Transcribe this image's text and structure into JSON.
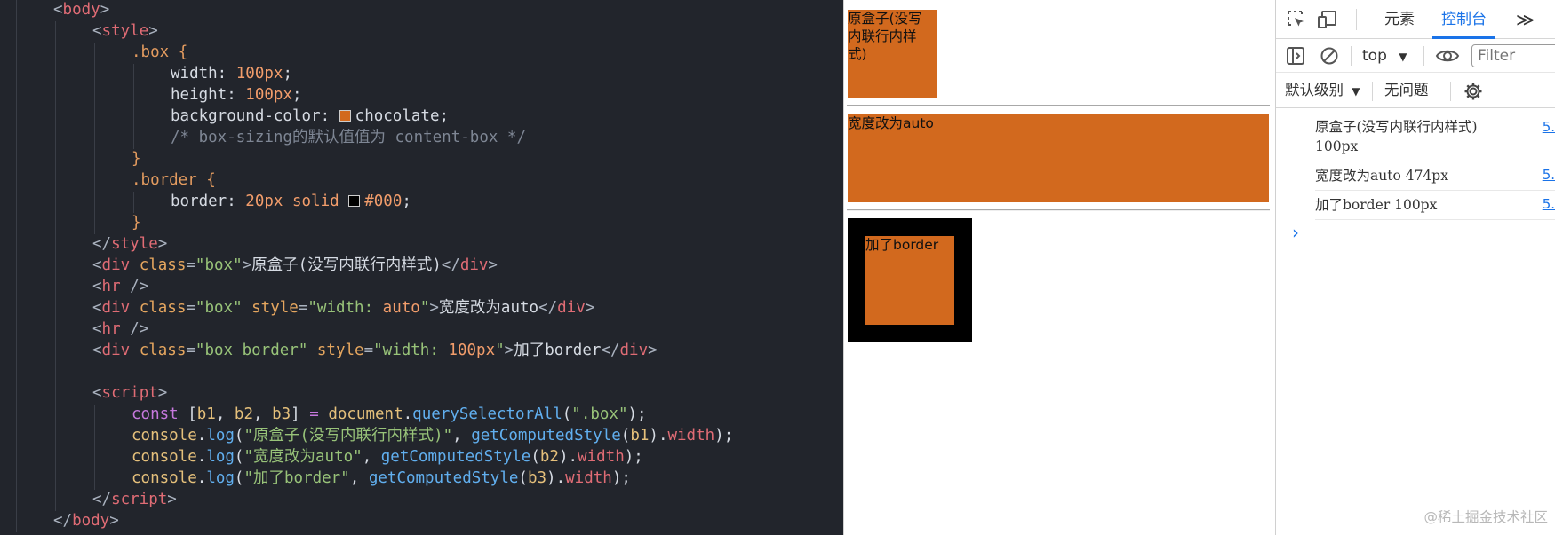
{
  "editor": {
    "lines": [
      [
        {
          "t": "<",
          "c": "k-punc"
        },
        {
          "t": "body",
          "c": "k-tag"
        },
        {
          "t": ">",
          "c": "k-punc"
        }
      ],
      [
        {
          "t": "<",
          "c": "k-punc"
        },
        {
          "t": "style",
          "c": "k-tag"
        },
        {
          "t": ">",
          "c": "k-punc"
        }
      ],
      [
        {
          "t": ".box ",
          "c": "k-sel"
        },
        {
          "t": "{",
          "c": "k-sel"
        }
      ],
      [
        {
          "t": "width: ",
          "c": "k-prop"
        },
        {
          "t": "100px",
          "c": "k-num"
        },
        {
          "t": ";",
          "c": "k-plain"
        }
      ],
      [
        {
          "t": "height: ",
          "c": "k-prop"
        },
        {
          "t": "100px",
          "c": "k-num"
        },
        {
          "t": ";",
          "c": "k-plain"
        }
      ],
      [
        {
          "t": "background-color: ",
          "c": "k-prop"
        },
        {
          "swatch": "#d2691e"
        },
        {
          "t": "chocolate",
          "c": "k-plain"
        },
        {
          "t": ";",
          "c": "k-plain"
        }
      ],
      [
        {
          "t": "/* box-sizing的默认值值为 content-box */",
          "c": "k-cmt"
        }
      ],
      [
        {
          "t": "}",
          "c": "k-sel"
        }
      ],
      [
        {
          "t": ".border ",
          "c": "k-sel"
        },
        {
          "t": "{",
          "c": "k-sel"
        }
      ],
      [
        {
          "t": "border: ",
          "c": "k-prop"
        },
        {
          "t": "20px",
          "c": "k-num"
        },
        {
          "t": " solid ",
          "c": "k-num"
        },
        {
          "swatch": "#000000"
        },
        {
          "t": "#000",
          "c": "k-num"
        },
        {
          "t": ";",
          "c": "k-plain"
        }
      ],
      [
        {
          "t": "}",
          "c": "k-sel"
        }
      ],
      [
        {
          "t": "</",
          "c": "k-punc"
        },
        {
          "t": "style",
          "c": "k-tag"
        },
        {
          "t": ">",
          "c": "k-punc"
        }
      ],
      [
        {
          "t": "<",
          "c": "k-punc"
        },
        {
          "t": "div",
          "c": "k-tag"
        },
        {
          "t": " class",
          "c": "k-attr"
        },
        {
          "t": "=",
          "c": "k-punc"
        },
        {
          "t": "\"box\"",
          "c": "k-str"
        },
        {
          "t": ">",
          "c": "k-punc"
        },
        {
          "t": "原盒子(没写内联行内样式)",
          "c": "k-plain"
        },
        {
          "t": "</",
          "c": "k-punc"
        },
        {
          "t": "div",
          "c": "k-tag"
        },
        {
          "t": ">",
          "c": "k-punc"
        }
      ],
      [
        {
          "t": "<",
          "c": "k-punc"
        },
        {
          "t": "hr",
          "c": "k-tag"
        },
        {
          "t": " />",
          "c": "k-punc"
        }
      ],
      [
        {
          "t": "<",
          "c": "k-punc"
        },
        {
          "t": "div",
          "c": "k-tag"
        },
        {
          "t": " class",
          "c": "k-attr"
        },
        {
          "t": "=",
          "c": "k-punc"
        },
        {
          "t": "\"box\"",
          "c": "k-str"
        },
        {
          "t": " style",
          "c": "k-attr"
        },
        {
          "t": "=",
          "c": "k-punc"
        },
        {
          "t": "\"width: ",
          "c": "k-str"
        },
        {
          "t": "auto",
          "c": "k-num"
        },
        {
          "t": "\"",
          "c": "k-str"
        },
        {
          "t": ">",
          "c": "k-punc"
        },
        {
          "t": "宽度改为auto",
          "c": "k-plain"
        },
        {
          "t": "</",
          "c": "k-punc"
        },
        {
          "t": "div",
          "c": "k-tag"
        },
        {
          "t": ">",
          "c": "k-punc"
        }
      ],
      [
        {
          "t": "<",
          "c": "k-punc"
        },
        {
          "t": "hr",
          "c": "k-tag"
        },
        {
          "t": " />",
          "c": "k-punc"
        }
      ],
      [
        {
          "t": "<",
          "c": "k-punc"
        },
        {
          "t": "div",
          "c": "k-tag"
        },
        {
          "t": " class",
          "c": "k-attr"
        },
        {
          "t": "=",
          "c": "k-punc"
        },
        {
          "t": "\"box border\"",
          "c": "k-str"
        },
        {
          "t": " style",
          "c": "k-attr"
        },
        {
          "t": "=",
          "c": "k-punc"
        },
        {
          "t": "\"width: ",
          "c": "k-str"
        },
        {
          "t": "100px",
          "c": "k-num"
        },
        {
          "t": "\"",
          "c": "k-str"
        },
        {
          "t": ">",
          "c": "k-punc"
        },
        {
          "t": "加了border",
          "c": "k-plain"
        },
        {
          "t": "</",
          "c": "k-punc"
        },
        {
          "t": "div",
          "c": "k-tag"
        },
        {
          "t": ">",
          "c": "k-punc"
        }
      ],
      [],
      [
        {
          "t": "<",
          "c": "k-punc"
        },
        {
          "t": "script",
          "c": "k-tag"
        },
        {
          "t": ">",
          "c": "k-punc"
        }
      ],
      [
        {
          "t": "const",
          "c": "k-kw"
        },
        {
          "t": " [",
          "c": "k-plain"
        },
        {
          "t": "b1",
          "c": "k-var"
        },
        {
          "t": ", ",
          "c": "k-plain"
        },
        {
          "t": "b2",
          "c": "k-var"
        },
        {
          "t": ", ",
          "c": "k-plain"
        },
        {
          "t": "b3",
          "c": "k-var"
        },
        {
          "t": "] ",
          "c": "k-plain"
        },
        {
          "t": "=",
          "c": "k-kw"
        },
        {
          "t": " document",
          "c": "k-var"
        },
        {
          "t": ".",
          "c": "k-plain"
        },
        {
          "t": "querySelectorAll",
          "c": "k-fn"
        },
        {
          "t": "(",
          "c": "k-plain"
        },
        {
          "t": "\".box\"",
          "c": "k-str"
        },
        {
          "t": ");",
          "c": "k-plain"
        }
      ],
      [
        {
          "t": "console",
          "c": "k-var"
        },
        {
          "t": ".",
          "c": "k-plain"
        },
        {
          "t": "log",
          "c": "k-fn"
        },
        {
          "t": "(",
          "c": "k-plain"
        },
        {
          "t": "\"原盒子(没写内联行内样式)\"",
          "c": "k-str"
        },
        {
          "t": ", ",
          "c": "k-plain"
        },
        {
          "t": "getComputedStyle",
          "c": "k-fn"
        },
        {
          "t": "(",
          "c": "k-plain"
        },
        {
          "t": "b1",
          "c": "k-var"
        },
        {
          "t": ").",
          "c": "k-plain"
        },
        {
          "t": "width",
          "c": "k-tag"
        },
        {
          "t": ");",
          "c": "k-plain"
        }
      ],
      [
        {
          "t": "console",
          "c": "k-var"
        },
        {
          "t": ".",
          "c": "k-plain"
        },
        {
          "t": "log",
          "c": "k-fn"
        },
        {
          "t": "(",
          "c": "k-plain"
        },
        {
          "t": "\"宽度改为auto\"",
          "c": "k-str"
        },
        {
          "t": ", ",
          "c": "k-plain"
        },
        {
          "t": "getComputedStyle",
          "c": "k-fn"
        },
        {
          "t": "(",
          "c": "k-plain"
        },
        {
          "t": "b2",
          "c": "k-var"
        },
        {
          "t": ").",
          "c": "k-plain"
        },
        {
          "t": "width",
          "c": "k-tag"
        },
        {
          "t": ");",
          "c": "k-plain"
        }
      ],
      [
        {
          "t": "console",
          "c": "k-var"
        },
        {
          "t": ".",
          "c": "k-plain"
        },
        {
          "t": "log",
          "c": "k-fn"
        },
        {
          "t": "(",
          "c": "k-plain"
        },
        {
          "t": "\"加了border\"",
          "c": "k-str"
        },
        {
          "t": ", ",
          "c": "k-plain"
        },
        {
          "t": "getComputedStyle",
          "c": "k-fn"
        },
        {
          "t": "(",
          "c": "k-plain"
        },
        {
          "t": "b3",
          "c": "k-var"
        },
        {
          "t": ").",
          "c": "k-plain"
        },
        {
          "t": "width",
          "c": "k-tag"
        },
        {
          "t": ");",
          "c": "k-plain"
        }
      ],
      [
        {
          "t": "</",
          "c": "k-punc"
        },
        {
          "t": "script",
          "c": "k-tag"
        },
        {
          "t": ">",
          "c": "k-punc"
        }
      ],
      [
        {
          "t": "</",
          "c": "k-punc"
        },
        {
          "t": "body",
          "c": "k-tag"
        },
        {
          "t": ">",
          "c": "k-punc"
        }
      ]
    ],
    "indents": [
      1,
      2,
      3,
      4,
      4,
      4,
      4,
      3,
      3,
      4,
      3,
      2,
      2,
      2,
      2,
      2,
      2,
      0,
      2,
      3,
      3,
      3,
      3,
      2,
      1
    ]
  },
  "preview": {
    "box1_text": "原盒子(没写内联行内样式)",
    "box2_text": "宽度改为auto",
    "box3_text": "加了border",
    "box_color": "#d2691e",
    "border_color": "#000000"
  },
  "devtools": {
    "tabs": {
      "elements": "元素",
      "console": "控制台",
      "more": "≫"
    },
    "context": "top",
    "filter_placeholder": "Filter",
    "levels": "默认级别",
    "issues": "无问题",
    "logs": [
      {
        "text": "原盒子(没写内联行内样式) 100px",
        "link": "5."
      },
      {
        "text": "宽度改为auto 474px",
        "link": "5."
      },
      {
        "text": "加了border 100px",
        "link": "5."
      }
    ],
    "prompt": "›",
    "accent": "#1a73e8"
  },
  "watermark": "@稀土掘金技术社区"
}
